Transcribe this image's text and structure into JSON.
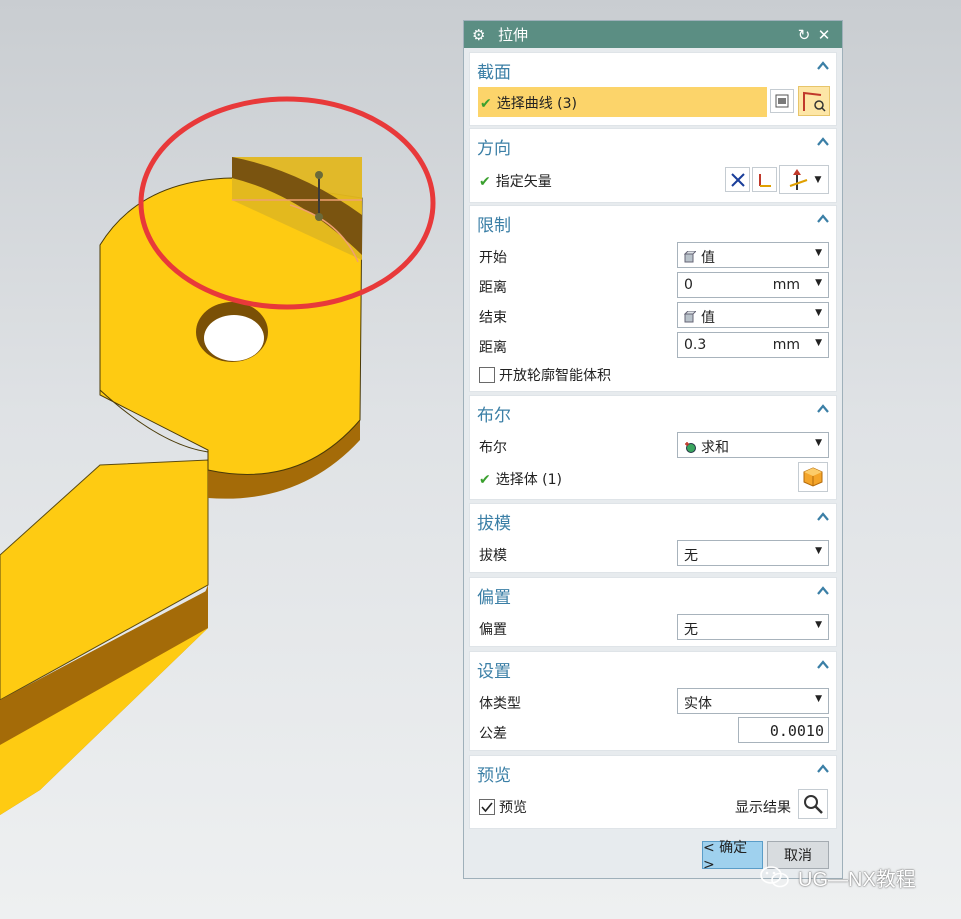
{
  "dialog": {
    "title": "拉伸",
    "sections": {
      "section": {
        "title": "截面",
        "select_curve": "选择曲线 (3)"
      },
      "direction": {
        "title": "方向",
        "specify_vector": "指定矢量"
      },
      "limits": {
        "title": "限制",
        "start_label": "开始",
        "start_value": "值",
        "start_distance_label": "距离",
        "start_distance": "0",
        "start_unit": "mm",
        "end_label": "结束",
        "end_value": "值",
        "end_distance_label": "距离",
        "end_distance": "0.3",
        "end_unit": "mm",
        "open_profile_label": "开放轮廓智能体积"
      },
      "boolean": {
        "title": "布尔",
        "label": "布尔",
        "value": "求和",
        "select_body": "选择体 (1)"
      },
      "draft": {
        "title": "拔模",
        "label": "拔模",
        "value": "无"
      },
      "offset": {
        "title": "偏置",
        "label": "偏置",
        "value": "无"
      },
      "settings": {
        "title": "设置",
        "body_type_label": "体类型",
        "body_type": "实体",
        "tolerance_label": "公差",
        "tolerance": "0.0010"
      },
      "preview": {
        "title": "预览",
        "preview_label": "预览",
        "show_result_label": "显示结果"
      }
    },
    "ok_label": "< 确定 >",
    "cancel_label": "取消"
  },
  "watermark": {
    "text": "UG—NX教程"
  },
  "colors": {
    "titlebar": "#5b8e83",
    "section_title": "#3b7fa6",
    "highlight": "#fcd46a",
    "part_yellow": "#fecb0f",
    "part_side": "#a46b08",
    "annotation_red": "#e8393a"
  }
}
